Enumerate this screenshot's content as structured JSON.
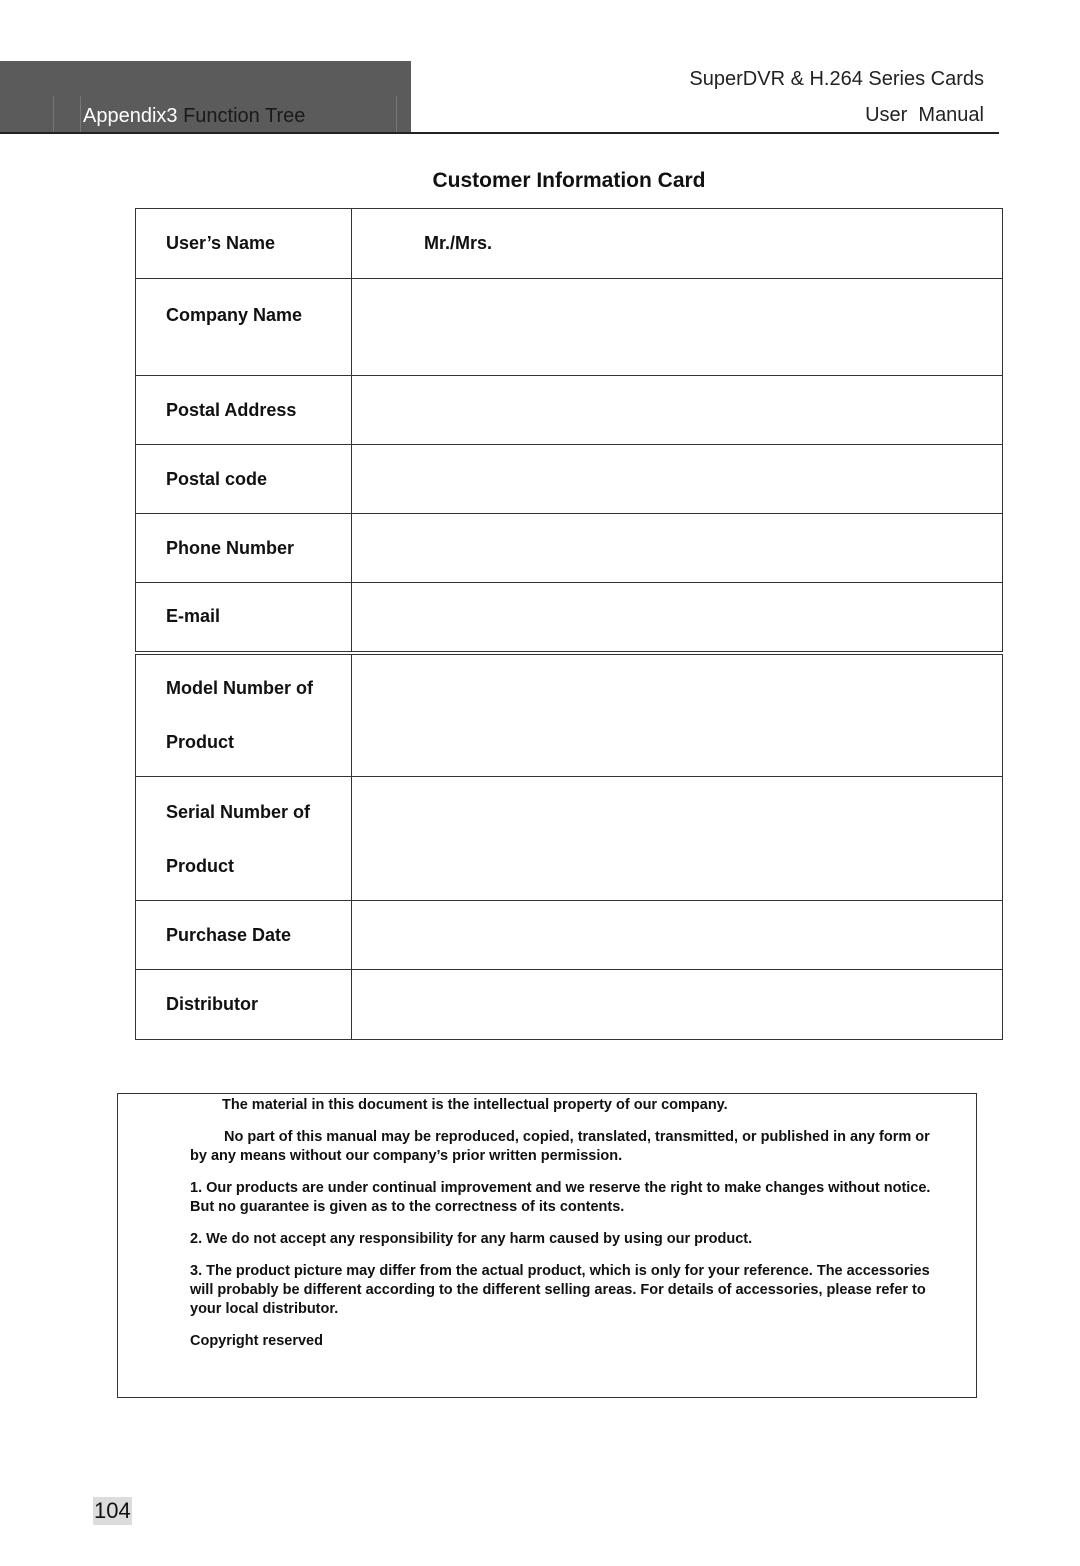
{
  "header": {
    "section_prefix": "Appendix3",
    "section_title": "Function Tree",
    "product": "SuperDVR & H.264 Series Cards",
    "doc_type": "User  Manual"
  },
  "card": {
    "title": "Customer Information Card",
    "rows": [
      {
        "label": "User’s Name",
        "value": "Mr./Mrs."
      },
      {
        "label": "Company Name",
        "value": ""
      },
      {
        "label": "Postal Address",
        "value": ""
      },
      {
        "label": "Postal code",
        "value": ""
      },
      {
        "label": "Phone Number",
        "value": ""
      },
      {
        "label": "E-mail",
        "value": ""
      },
      {
        "label_line1": "Model Number of",
        "label_line2": "Product",
        "value": ""
      },
      {
        "label_line1": "Serial Number of",
        "label_line2": "Product",
        "value": ""
      },
      {
        "label": "Purchase Date",
        "value": ""
      },
      {
        "label": "Distributor",
        "value": ""
      }
    ]
  },
  "notice": {
    "line1": "The material in this document is the intellectual property of our company.",
    "line2a": "No part of this manual may be reproduced, copied, translated, transmitted, or published in any form or",
    "line2b": "by any means without our company’s prior written permission.",
    "item1a": "1. Our products are under continual improvement and we reserve the right to make changes without notice.",
    "item1b": "But no guarantee is given as to the correctness of its contents.",
    "item2": "2. We do not accept any responsibility for any harm caused by using our product.",
    "item3a": "3. The product picture may differ from the actual product, which is only for your reference. The accessories",
    "item3b": "will probably be different according to the different selling areas. For details of accessories, please refer to",
    "item3c": "your local distributor.",
    "copyright": "Copyright reserved"
  },
  "footer": {
    "page_number": "104"
  }
}
